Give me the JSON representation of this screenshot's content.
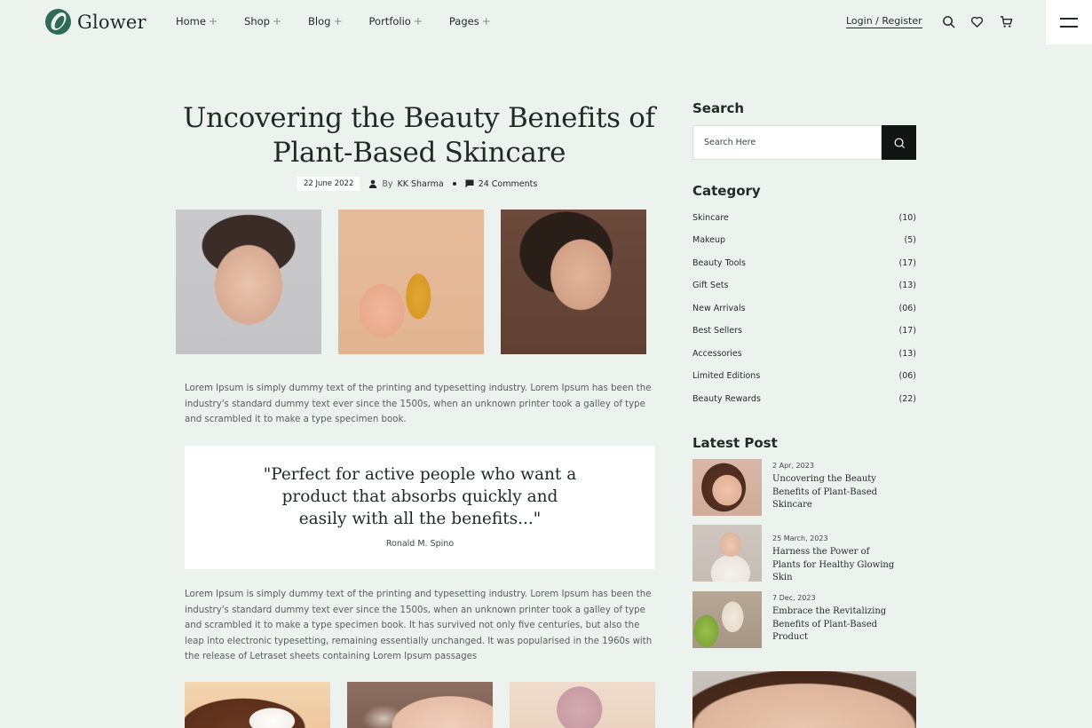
{
  "brand": {
    "name": "Glower"
  },
  "nav": {
    "items": [
      {
        "label": "Home"
      },
      {
        "label": "Shop"
      },
      {
        "label": "Blog"
      },
      {
        "label": "Portfolio"
      },
      {
        "label": "Pages"
      }
    ],
    "plus_symbol": "+",
    "login_label": "Login / Register"
  },
  "article": {
    "title": "Uncovering the Beauty Benefits of Plant-Based Skincare",
    "date": "22 June 2022",
    "by_label": "By",
    "author": "KK Sharma",
    "comments": "24 Comments",
    "paragraph1": "Lorem Ipsum is simply dummy text of the printing and typesetting industry. Lorem Ipsum has been the industry's standard dummy text ever since the 1500s, when an unknown printer took a galley of type and scrambled it to make a type specimen book.",
    "quote": "\"Perfect for active people who want a product that absorbs quickly and easily with all the benefits...\"",
    "quote_author": "Ronald M. Spino",
    "paragraph2": "Lorem Ipsum is simply dummy text of the printing and typesetting industry. Lorem Ipsum has been the industry's standard dummy text ever since the 1500s, when an unknown printer took a galley of type and scrambled it to make a type specimen book. It has survived not only five centuries, but also the leap into electronic typesetting, remaining essentially unchanged. It was popularised in the 1960s with the release of Letraset sheets containing Lorem Ipsum passages"
  },
  "sidebar": {
    "search_heading": "Search",
    "search_placeholder": "Search Here",
    "category_heading": "Category",
    "categories": [
      {
        "name": "Skincare",
        "count": "(10)"
      },
      {
        "name": "Makeup",
        "count": "(5)"
      },
      {
        "name": "Beauty Tools",
        "count": "(17)"
      },
      {
        "name": "Gift Sets",
        "count": "(13)"
      },
      {
        "name": "New Arrivals",
        "count": "(06)"
      },
      {
        "name": "Best Sellers",
        "count": "(17)"
      },
      {
        "name": "Accessories",
        "count": "(13)"
      },
      {
        "name": "Limited Editions",
        "count": "(06)"
      },
      {
        "name": "Beauty Rewards",
        "count": "(22)"
      }
    ],
    "latest_heading": "Latest Post",
    "latest_posts": [
      {
        "date": "2 Apr, 2023",
        "title": "Uncovering the Beauty Benefits of Plant-Based Skincare"
      },
      {
        "date": "25 March, 2023",
        "title": "Harness the Power of Plants for Healthy Glowing Skin"
      },
      {
        "date": "7 Dec, 2023",
        "title": "Embrace the Revitalizing Benefits of Plant-Based Product"
      }
    ]
  },
  "colors": {
    "background": "#ecf3ef",
    "brand_green": "#2f6b52",
    "text_dark": "#1f2a26",
    "search_button": "#111614"
  }
}
